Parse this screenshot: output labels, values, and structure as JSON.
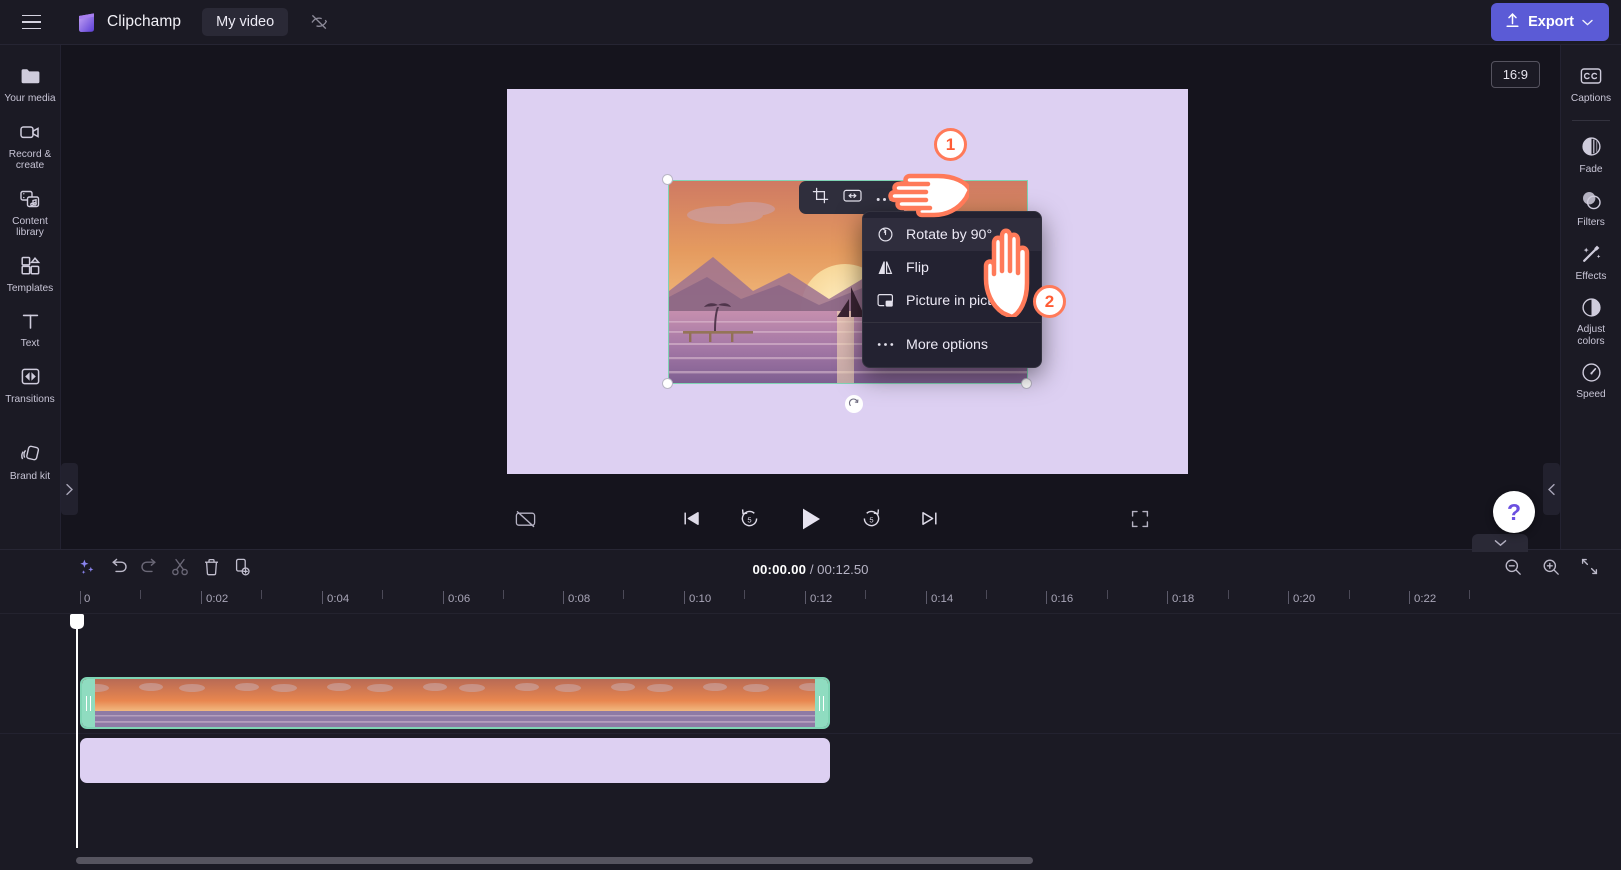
{
  "topbar": {
    "menu_icon": "hamburger-icon",
    "brand": "Clipchamp",
    "project_name": "My video",
    "visibility_icon": "eye-off-icon",
    "export_label": "Export",
    "export_icon": "upload-icon",
    "export_color": "#5b5bd6"
  },
  "left_rail": {
    "items": [
      {
        "label": "Your media",
        "icon": "folder-icon"
      },
      {
        "label": "Record &\ncreate",
        "line1": "Record &",
        "line2": "create",
        "icon": "video-camera-icon"
      },
      {
        "label": "Content\nlibrary",
        "line1": "Content",
        "line2": "library",
        "icon": "media-library-icon"
      },
      {
        "label": "Templates",
        "icon": "templates-icon"
      },
      {
        "label": "Text",
        "icon": "text-icon"
      },
      {
        "label": "Transitions",
        "icon": "transitions-icon"
      },
      {
        "label": "Brand kit",
        "icon": "brand-kit-icon"
      }
    ]
  },
  "right_rail": {
    "items": [
      {
        "label": "Captions",
        "icon": "closed-caption-icon"
      },
      {
        "label": "Fade",
        "icon": "fade-icon"
      },
      {
        "label": "Filters",
        "icon": "filters-icon"
      },
      {
        "label": "Effects",
        "icon": "effects-wand-icon"
      },
      {
        "label": "Adjust\ncolors",
        "line1": "Adjust",
        "line2": "colors",
        "icon": "adjust-colors-icon"
      },
      {
        "label": "Speed",
        "icon": "speed-gauge-icon"
      }
    ]
  },
  "preview": {
    "aspect_ratio": "16:9",
    "canvas_color": "#ddd0f2",
    "selection_color": "#7fd4b4",
    "mini_toolbar": [
      {
        "icon": "crop-icon",
        "name": "crop-button"
      },
      {
        "icon": "fit-fill-icon",
        "name": "fit-button"
      },
      {
        "icon": "more-dots-icon",
        "name": "more-button"
      }
    ],
    "context_menu": {
      "items": [
        {
          "label": "Rotate by 90°",
          "icon": "rotate-icon",
          "active": true
        },
        {
          "label": "Flip",
          "icon": "flip-icon",
          "active": false
        },
        {
          "label": "Picture in picture",
          "icon": "picture-in-picture-icon",
          "active": false
        }
      ],
      "footer": {
        "label": "More options",
        "icon": "more-dots-icon"
      }
    },
    "annotations": [
      {
        "badge": "1"
      },
      {
        "badge": "2"
      }
    ],
    "annotation_color": "#ff7a59"
  },
  "playback": {
    "hide_captions_icon": "captions-off-icon",
    "skip_start_icon": "skip-to-start-icon",
    "back5_icon": "rewind-5-icon",
    "play_icon": "play-icon",
    "forward5_icon": "forward-5-icon",
    "skip_end_icon": "skip-to-end-icon",
    "fullscreen_icon": "fullscreen-icon"
  },
  "help": {
    "icon": "question-mark-icon",
    "label": "?"
  },
  "timeline": {
    "toolbar": [
      {
        "icon": "magic-sparkle-icon",
        "name": "auto-compose-button"
      },
      {
        "icon": "undo-icon",
        "name": "undo-button"
      },
      {
        "icon": "redo-icon",
        "name": "redo-button"
      },
      {
        "icon": "scissors-icon",
        "name": "split-button"
      },
      {
        "icon": "trash-icon",
        "name": "delete-button"
      },
      {
        "icon": "duplicate-icon",
        "name": "duplicate-button"
      }
    ],
    "current_time": "00:00.00",
    "time_separator": " / ",
    "total_time": "00:12.50",
    "zoom_out_icon": "zoom-out-icon",
    "zoom_in_icon": "zoom-in-icon",
    "fit_icon": "fit-timeline-icon",
    "collapse_icon": "chevron-down-icon",
    "ruler_labels": [
      "0",
      "0:02",
      "0:04",
      "0:06",
      "0:08",
      "0:10",
      "0:12",
      "0:14",
      "0:16",
      "0:18",
      "0:20",
      "0:22"
    ],
    "clips": [
      {
        "name": "video-clip",
        "type": "video",
        "selected": true
      },
      {
        "name": "audio-clip",
        "type": "audio",
        "color": "#ddd0f2"
      }
    ]
  }
}
